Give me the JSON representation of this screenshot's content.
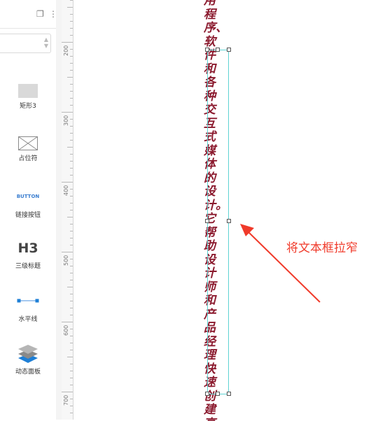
{
  "panel": {
    "widgets": [
      {
        "id": "rectangle",
        "label": "矩形3"
      },
      {
        "id": "placeholder",
        "label": "占位符"
      },
      {
        "id": "link-button",
        "label": "链接按钮",
        "preview": "BUTTON"
      },
      {
        "id": "heading",
        "label": "三级标题",
        "preview": "H3"
      },
      {
        "id": "horizontal-line",
        "label": "水平线"
      },
      {
        "id": "dynamic-panel",
        "label": "动态面板"
      }
    ]
  },
  "ruler": {
    "labels": [
      "200",
      "300",
      "400",
      "500",
      "600",
      "700"
    ]
  },
  "canvas": {
    "text_content": "用程序、软件和各种交互式媒体的设计。它帮助设计师和产品经理快速创建高保",
    "annotation": "将文本框拉窄"
  },
  "colors": {
    "text": "#8b1a2e",
    "annotation": "#f03a2a",
    "selection": "#5fd3d3"
  }
}
